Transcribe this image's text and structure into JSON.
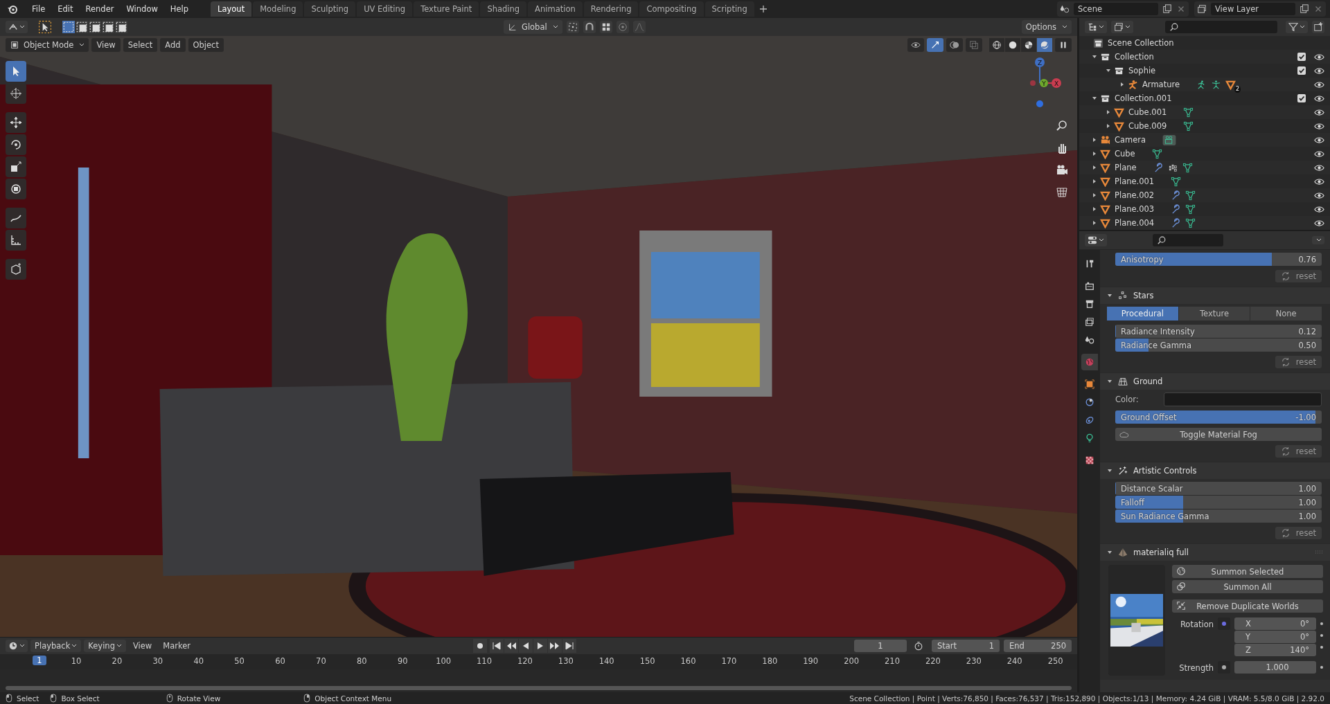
{
  "menu": [
    "File",
    "Edit",
    "Render",
    "Window",
    "Help"
  ],
  "workspaces": [
    {
      "label": "Layout",
      "selected": true
    },
    {
      "label": "Modeling",
      "selected": false
    },
    {
      "label": "Sculpting",
      "selected": false
    },
    {
      "label": "UV Editing",
      "selected": false
    },
    {
      "label": "Texture Paint",
      "selected": false
    },
    {
      "label": "Shading",
      "selected": false
    },
    {
      "label": "Animation",
      "selected": false
    },
    {
      "label": "Rendering",
      "selected": false
    },
    {
      "label": "Compositing",
      "selected": false
    },
    {
      "label": "Scripting",
      "selected": false
    }
  ],
  "scene": {
    "name": "Scene"
  },
  "view_layer": {
    "name": "View Layer"
  },
  "tool_header": {
    "select_modes": [
      {
        "selected": true
      },
      {
        "selected": false
      },
      {
        "selected": false
      },
      {
        "selected": false
      },
      {
        "selected": false
      }
    ],
    "orientation": "Global",
    "options": "Options"
  },
  "viewport": {
    "mode": "Object Mode",
    "menus": [
      "View",
      "Select",
      "Add",
      "Object"
    ],
    "tools": [
      {
        "kind": "select",
        "selected": true
      },
      {
        "kind": "cursor",
        "selected": false
      },
      {
        "kind": "move",
        "selected": false
      },
      {
        "kind": "rotate",
        "selected": false
      },
      {
        "kind": "scale",
        "selected": false
      },
      {
        "kind": "transform",
        "selected": false
      },
      {
        "kind": "annotate",
        "selected": false
      },
      {
        "kind": "measure",
        "selected": false
      },
      {
        "kind": "add-cube",
        "selected": false
      }
    ],
    "shading": [
      {
        "kind": "wireframe",
        "selected": false
      },
      {
        "kind": "solid",
        "selected": false
      },
      {
        "kind": "material",
        "selected": false
      },
      {
        "kind": "rendered",
        "selected": true
      }
    ],
    "gizmo": {
      "x": "X",
      "y": "Y",
      "z": "Z"
    }
  },
  "outliner": {
    "root": "Scene Collection",
    "items": [
      {
        "name": "Collection",
        "kind": "collection",
        "expanded": true,
        "checked": true,
        "children": [
          {
            "name": "Sophie",
            "kind": "collection",
            "expanded": true,
            "checked": true,
            "children": [
              {
                "name": "Armature",
                "kind": "armature",
                "expanded": false,
                "extras": [
                  {
                    "kind": "pose"
                  },
                  {
                    "kind": "armature-data"
                  },
                  {
                    "kind": "mesh-object",
                    "count": "2"
                  }
                ]
              }
            ]
          }
        ]
      },
      {
        "name": "Collection.001",
        "kind": "collection",
        "expanded": true,
        "checked": true,
        "children": [
          {
            "name": "Cube.001",
            "kind": "mesh",
            "expanded": false,
            "extras": [
              {
                "kind": "mesh-data"
              }
            ]
          },
          {
            "name": "Cube.009",
            "kind": "mesh",
            "expanded": false,
            "extras": [
              {
                "kind": "mesh-data"
              }
            ]
          }
        ]
      },
      {
        "name": "Camera",
        "kind": "camera",
        "expanded": false,
        "extras": [
          {
            "kind": "camera-data"
          }
        ]
      },
      {
        "name": "Cube",
        "kind": "mesh",
        "expanded": false,
        "extras": [
          {
            "kind": "mesh-data"
          }
        ]
      },
      {
        "name": "Plane",
        "kind": "mesh",
        "expanded": false,
        "extras": [
          {
            "kind": "wrench"
          },
          {
            "kind": "particles"
          },
          {
            "kind": "mesh-data"
          }
        ]
      },
      {
        "name": "Plane.001",
        "kind": "mesh",
        "expanded": false,
        "extras": [
          {
            "kind": "mesh-data"
          }
        ]
      },
      {
        "name": "Plane.002",
        "kind": "mesh",
        "expanded": false,
        "extras": [
          {
            "kind": "wrench"
          },
          {
            "kind": "mesh-data"
          }
        ]
      },
      {
        "name": "Plane.003",
        "kind": "mesh",
        "expanded": false,
        "extras": [
          {
            "kind": "wrench"
          },
          {
            "kind": "mesh-data"
          }
        ]
      },
      {
        "name": "Plane.004",
        "kind": "mesh",
        "expanded": false,
        "extras": [
          {
            "kind": "wrench"
          },
          {
            "kind": "mesh-data"
          }
        ]
      }
    ]
  },
  "properties": {
    "tabs": [
      {
        "kind": "tool",
        "selected": false
      },
      {
        "kind": "render",
        "selected": false
      },
      {
        "kind": "output",
        "selected": false
      },
      {
        "kind": "view-layer",
        "selected": false
      },
      {
        "kind": "scene",
        "selected": false
      },
      {
        "kind": "world",
        "selected": true
      },
      {
        "kind": "object",
        "selected": false
      },
      {
        "kind": "physics",
        "selected": false
      },
      {
        "kind": "constraints",
        "selected": false
      },
      {
        "kind": "data",
        "selected": false
      },
      {
        "kind": "texture",
        "selected": false
      }
    ],
    "sections": [
      {
        "rows": [
          {
            "kind": "sliders",
            "items": [
              {
                "label": "Anisotropy",
                "value": "0.76",
                "level": 0.76
              }
            ]
          },
          {
            "kind": "reset",
            "label": "reset"
          }
        ]
      },
      {
        "title": "Stars",
        "kind": "stars",
        "expanded": true,
        "rows": [
          {
            "kind": "segmented",
            "options": [
              {
                "label": "Procedural",
                "selected": true
              },
              {
                "label": "Texture",
                "selected": false
              },
              {
                "label": "None",
                "selected": false
              }
            ]
          },
          {
            "kind": "sliders",
            "items": [
              {
                "label": "Radiance Intensity",
                "value": "0.12",
                "level": 0.0
              },
              {
                "label": "Radiance Gamma",
                "value": "0.50",
                "level": 0.16
              }
            ]
          },
          {
            "kind": "reset",
            "label": "reset"
          }
        ]
      },
      {
        "title": "Ground",
        "kind": "ground",
        "expanded": true,
        "rows": [
          {
            "kind": "color",
            "label": "Color:"
          },
          {
            "kind": "sliders",
            "items": [
              {
                "label": "Ground Offset",
                "value": "-1.00",
                "level": 0.97
              }
            ]
          },
          {
            "kind": "button",
            "label": "Toggle Material Fog"
          },
          {
            "kind": "reset",
            "label": "reset"
          }
        ]
      },
      {
        "title": "Artistic Controls",
        "kind": "sparkle",
        "expanded": true,
        "rows": [
          {
            "kind": "sliders",
            "items": [
              {
                "label": "Distance Scalar",
                "value": "1.00",
                "level": 0.0
              },
              {
                "label": "Falloff",
                "value": "1.00",
                "level": 0.33
              },
              {
                "label": "Sun Radiance Gamma",
                "value": "1.00",
                "level": 0.33
              }
            ]
          },
          {
            "kind": "reset",
            "label": "reset"
          }
        ]
      }
    ],
    "addon": {
      "title": "materialiq full",
      "expanded": true,
      "buttons": [
        {
          "kind": "globe",
          "label": "Summon Selected"
        },
        {
          "kind": "rings",
          "label": "Summon All"
        },
        {
          "kind": "merge",
          "label": "Remove Duplicate Worlds"
        }
      ],
      "rotation": {
        "label": "Rotation",
        "axes": [
          {
            "axis": "X",
            "value": "0°"
          },
          {
            "axis": "Y",
            "value": "0°"
          },
          {
            "axis": "Z",
            "value": "140°"
          }
        ]
      },
      "strength": {
        "label": "Strength",
        "value": "1.000"
      }
    }
  },
  "timeline": {
    "menus": [
      "Playback",
      "Keying",
      "View",
      "Marker"
    ],
    "current_frame": "1",
    "start": {
      "label": "Start",
      "value": "1"
    },
    "end": {
      "label": "End",
      "value": "250"
    },
    "ruler": {
      "current": "1",
      "ticks": [
        "10",
        "20",
        "30",
        "40",
        "50",
        "60",
        "70",
        "80",
        "90",
        "100",
        "110",
        "120",
        "130",
        "140",
        "150",
        "160",
        "170",
        "180",
        "190",
        "200",
        "210",
        "220",
        "230",
        "240",
        "250"
      ]
    }
  },
  "status_bar": {
    "hints": [
      {
        "kind": "left",
        "label": "Select"
      },
      {
        "kind": "left",
        "label": "Box Select"
      },
      {
        "kind": "middle",
        "label": "Rotate View"
      },
      {
        "kind": "right",
        "label": "Object Context Menu"
      }
    ],
    "stats": "Scene Collection | Point | Verts:76,850 | Faces:76,537 | Tris:152,890 | Objects:1/13 | Memory: 4.24 GiB | VRAM: 5.5/8.0 GiB | 2.92.0"
  }
}
